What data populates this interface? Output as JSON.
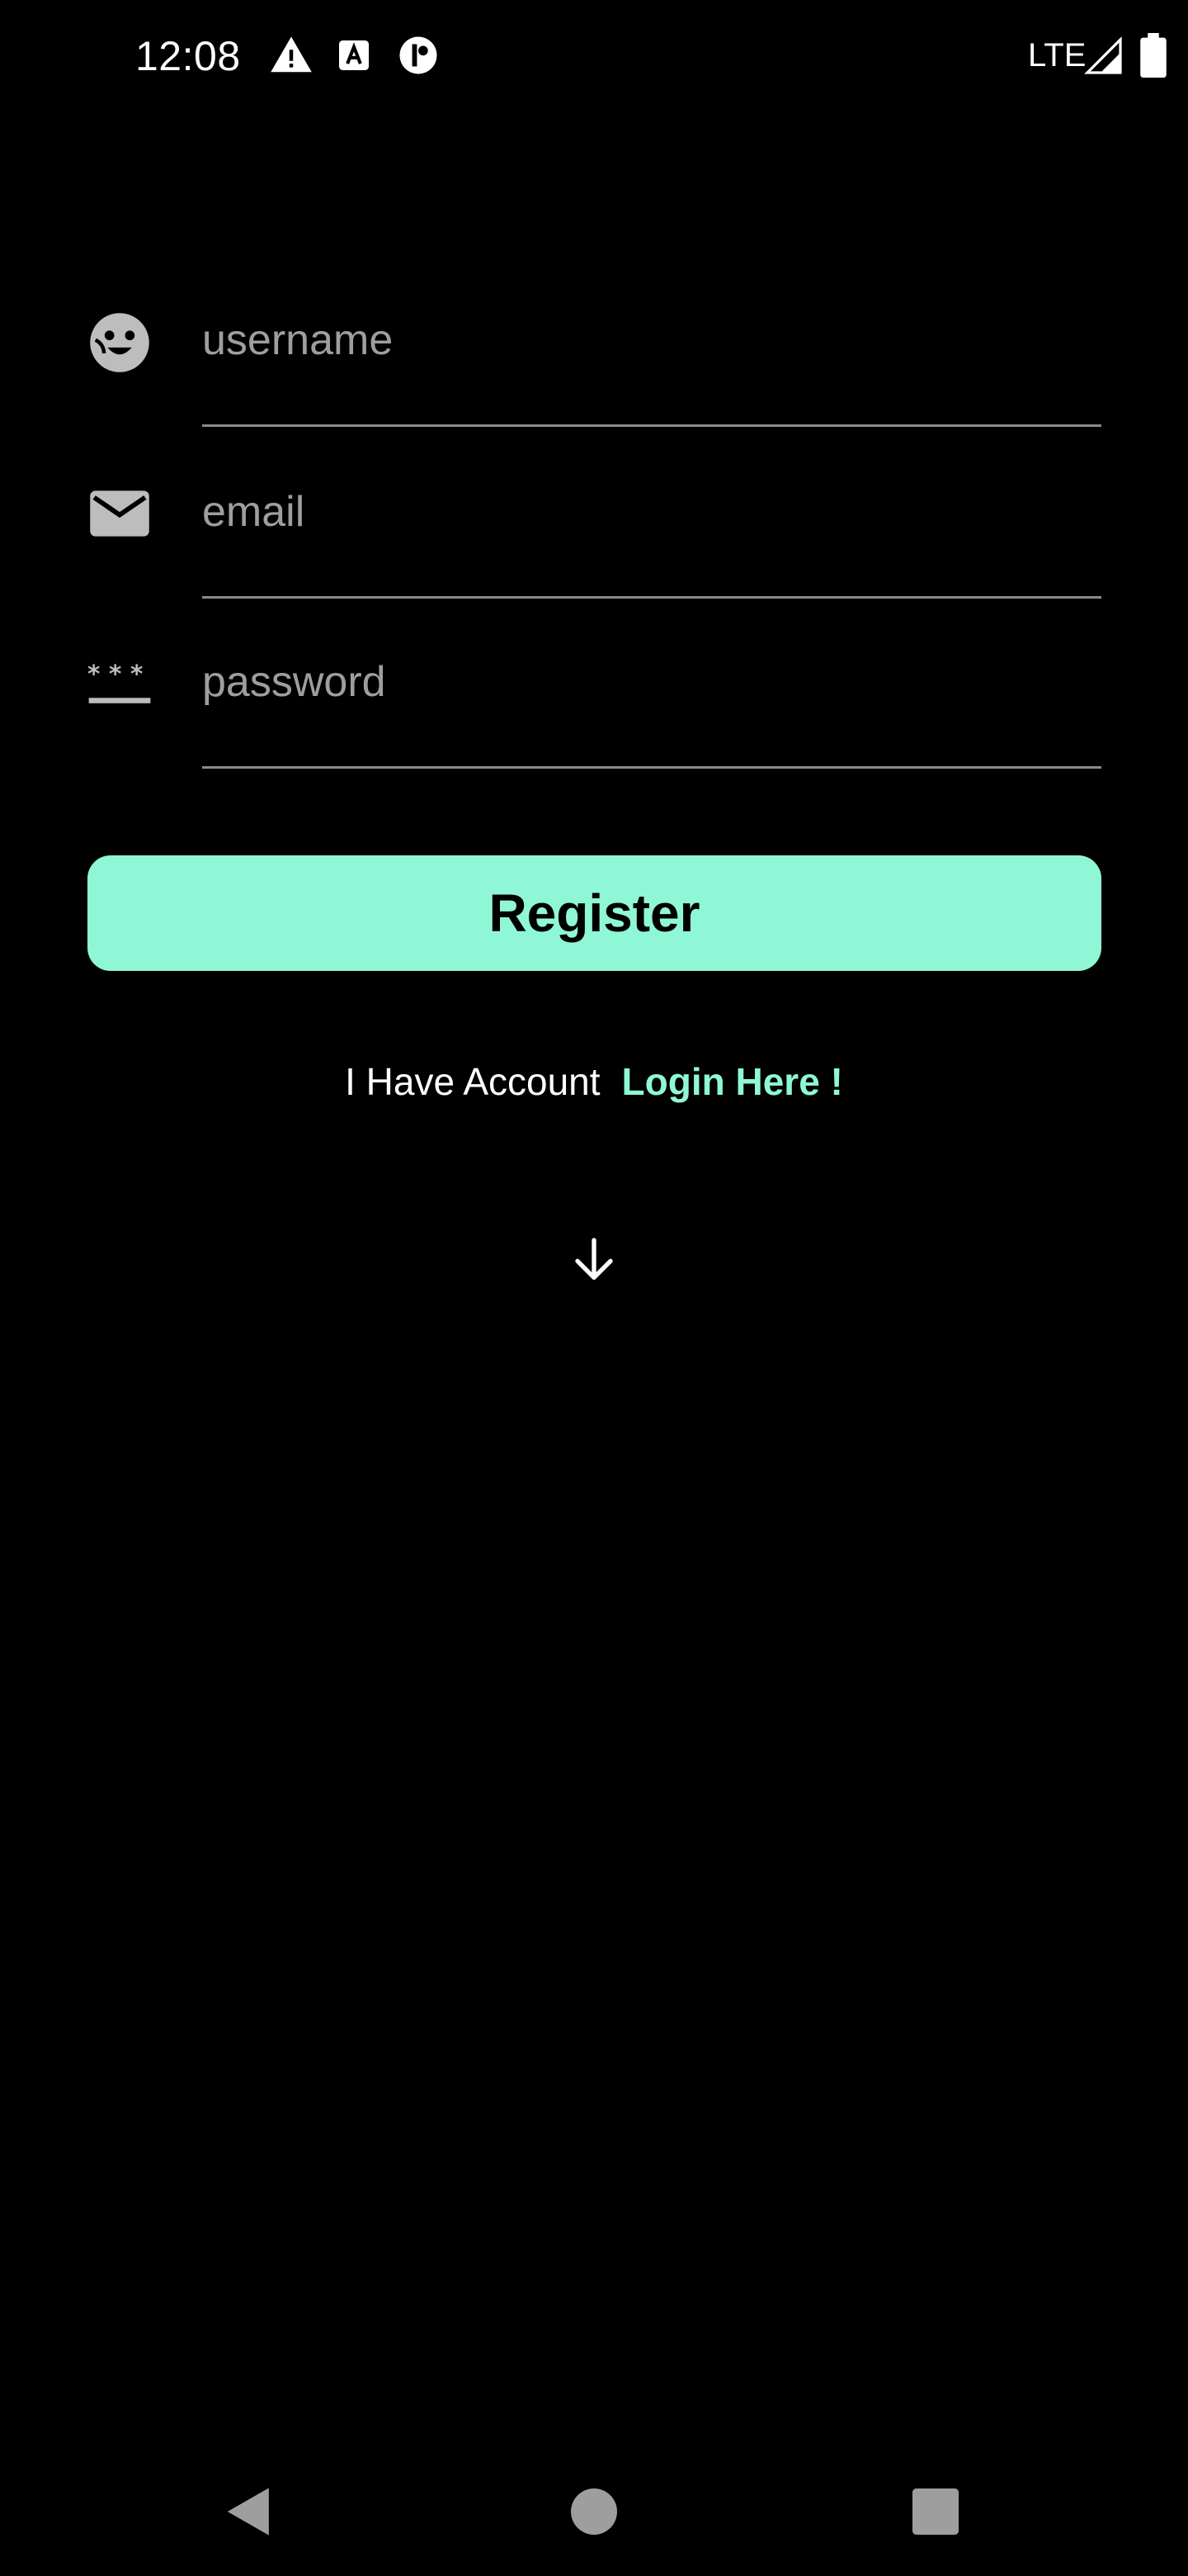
{
  "status_bar": {
    "time": "12:08",
    "network": "LTE",
    "icons": [
      "warning-icon",
      "font-a-icon",
      "app-badge-icon",
      "signal-icon",
      "battery-icon"
    ]
  },
  "form": {
    "username": {
      "placeholder": "username",
      "value": "",
      "icon": "face-icon"
    },
    "email": {
      "placeholder": "email",
      "value": "",
      "icon": "mail-icon"
    },
    "password": {
      "placeholder": "password",
      "value": "",
      "icon": "password-icon"
    }
  },
  "register_button": {
    "label": "Register"
  },
  "login_prompt": {
    "prefix": "I Have Account",
    "link": "Login Here !"
  },
  "scroll_indicator": {
    "icon": "arrow-down-icon"
  },
  "nav_bar": {
    "icons": [
      "back-icon",
      "home-icon",
      "recents-icon"
    ]
  },
  "colors": {
    "background": "#000000",
    "accent": "#8ff7d6",
    "placeholder": "#9e9e9e",
    "underline": "#8a8a8a"
  }
}
